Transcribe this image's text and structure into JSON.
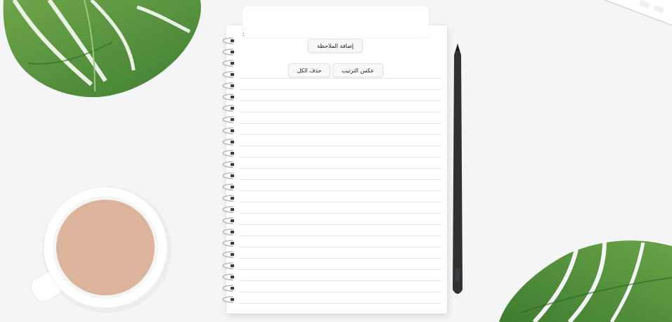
{
  "note_input": {
    "value": "",
    "placeholder": "",
    "marker": ":"
  },
  "buttons": {
    "add_note": "إضافة الملاحظة",
    "delete_all": "حذف الكل",
    "reverse_order": "عكس الترتيب"
  },
  "notes": [],
  "colors": {
    "background": "#f4f5f6",
    "leaf": "#4f8f3a",
    "coffee": "#dcb39b",
    "pencil": "#2f3133"
  },
  "icons": {
    "leaf_top_left": "monstera-leaf",
    "leaf_bottom_right": "monstera-leaf",
    "coffee_cup": "coffee-cup",
    "pencil": "pencil",
    "keyboard": "keyboard"
  }
}
